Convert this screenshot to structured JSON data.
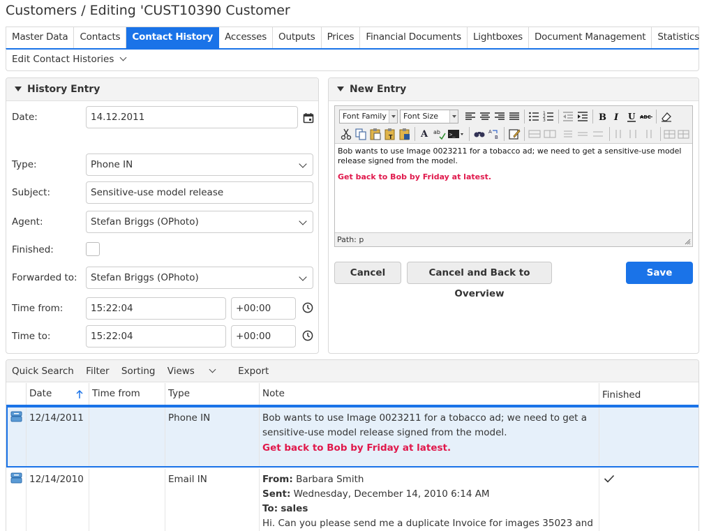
{
  "page": {
    "title": "Customers / Editing 'CUST10390 Customer"
  },
  "tabs": [
    {
      "label": "Master Data"
    },
    {
      "label": "Contacts"
    },
    {
      "label": "Contact History",
      "active": true
    },
    {
      "label": "Accesses"
    },
    {
      "label": "Outputs"
    },
    {
      "label": "Prices"
    },
    {
      "label": "Financial Documents"
    },
    {
      "label": "Lightboxes"
    },
    {
      "label": "Document Management"
    },
    {
      "label": "Statistics"
    }
  ],
  "subbar": {
    "label": "Edit Contact Histories"
  },
  "history_entry": {
    "title": "History Entry",
    "date": {
      "label": "Date:",
      "value": "14.12.2011"
    },
    "type": {
      "label": "Type:",
      "value": "Phone IN"
    },
    "subject": {
      "label": "Subject:",
      "value": "Sensitive-use model release"
    },
    "agent": {
      "label": "Agent:",
      "value": "Stefan Briggs (OPhoto)"
    },
    "finished": {
      "label": "Finished:",
      "checked": false
    },
    "forwarded": {
      "label": "Forwarded to:",
      "value": "Stefan Briggs (OPhoto)"
    },
    "time_from": {
      "label": "Time from:",
      "value": "15:22:04",
      "tz": "+00:00"
    },
    "time_to": {
      "label": "Time to:",
      "value": "15:22:04",
      "tz": "+00:00"
    }
  },
  "new_entry": {
    "title": "New Entry",
    "toolbar": {
      "font_family": "Font Family",
      "font_size": "Font Size"
    },
    "body_text": "Bob wants to use Image 0023211 for a tobacco ad; we need to get a sensitive-use model release signed from the model.",
    "body_red": "Get back to Bob by Friday at latest.",
    "path": "Path: p",
    "cancel": "Cancel",
    "cancel_back": "Cancel and Back to Overview",
    "save": "Save"
  },
  "grid": {
    "toolbar": {
      "quick_search": "Quick Search",
      "filter": "Filter",
      "sorting": "Sorting",
      "views": "Views",
      "export": "Export"
    },
    "columns": {
      "date": "Date",
      "time_from": "Time from",
      "type": "Type",
      "note": "Note",
      "finished": "Finished"
    },
    "rows": [
      {
        "date": "12/14/2011",
        "time_from": "",
        "type": "Phone IN",
        "note": "Bob wants to use Image 0023211 for a tobacco ad; we need to get a sensitive-use model release signed from the model.",
        "note_red": "Get back to Bob by Friday at latest.",
        "finished": false
      },
      {
        "date": "12/14/2010",
        "time_from": "",
        "type": "Email IN",
        "from_label": "From:",
        "from": "Barbara Smith",
        "sent_label": "Sent:",
        "sent": "Wednesday, December 14, 2010 6:14 AM",
        "to_label": "To:",
        "to": "sales",
        "body": "Hi. Can you please send me a duplicate Invoice for images 35023 and",
        "finished": true
      }
    ]
  },
  "colors": {
    "accent": "#1a73e8",
    "highlight_row": "#e6f0fa",
    "red_note": "#e0194c"
  }
}
